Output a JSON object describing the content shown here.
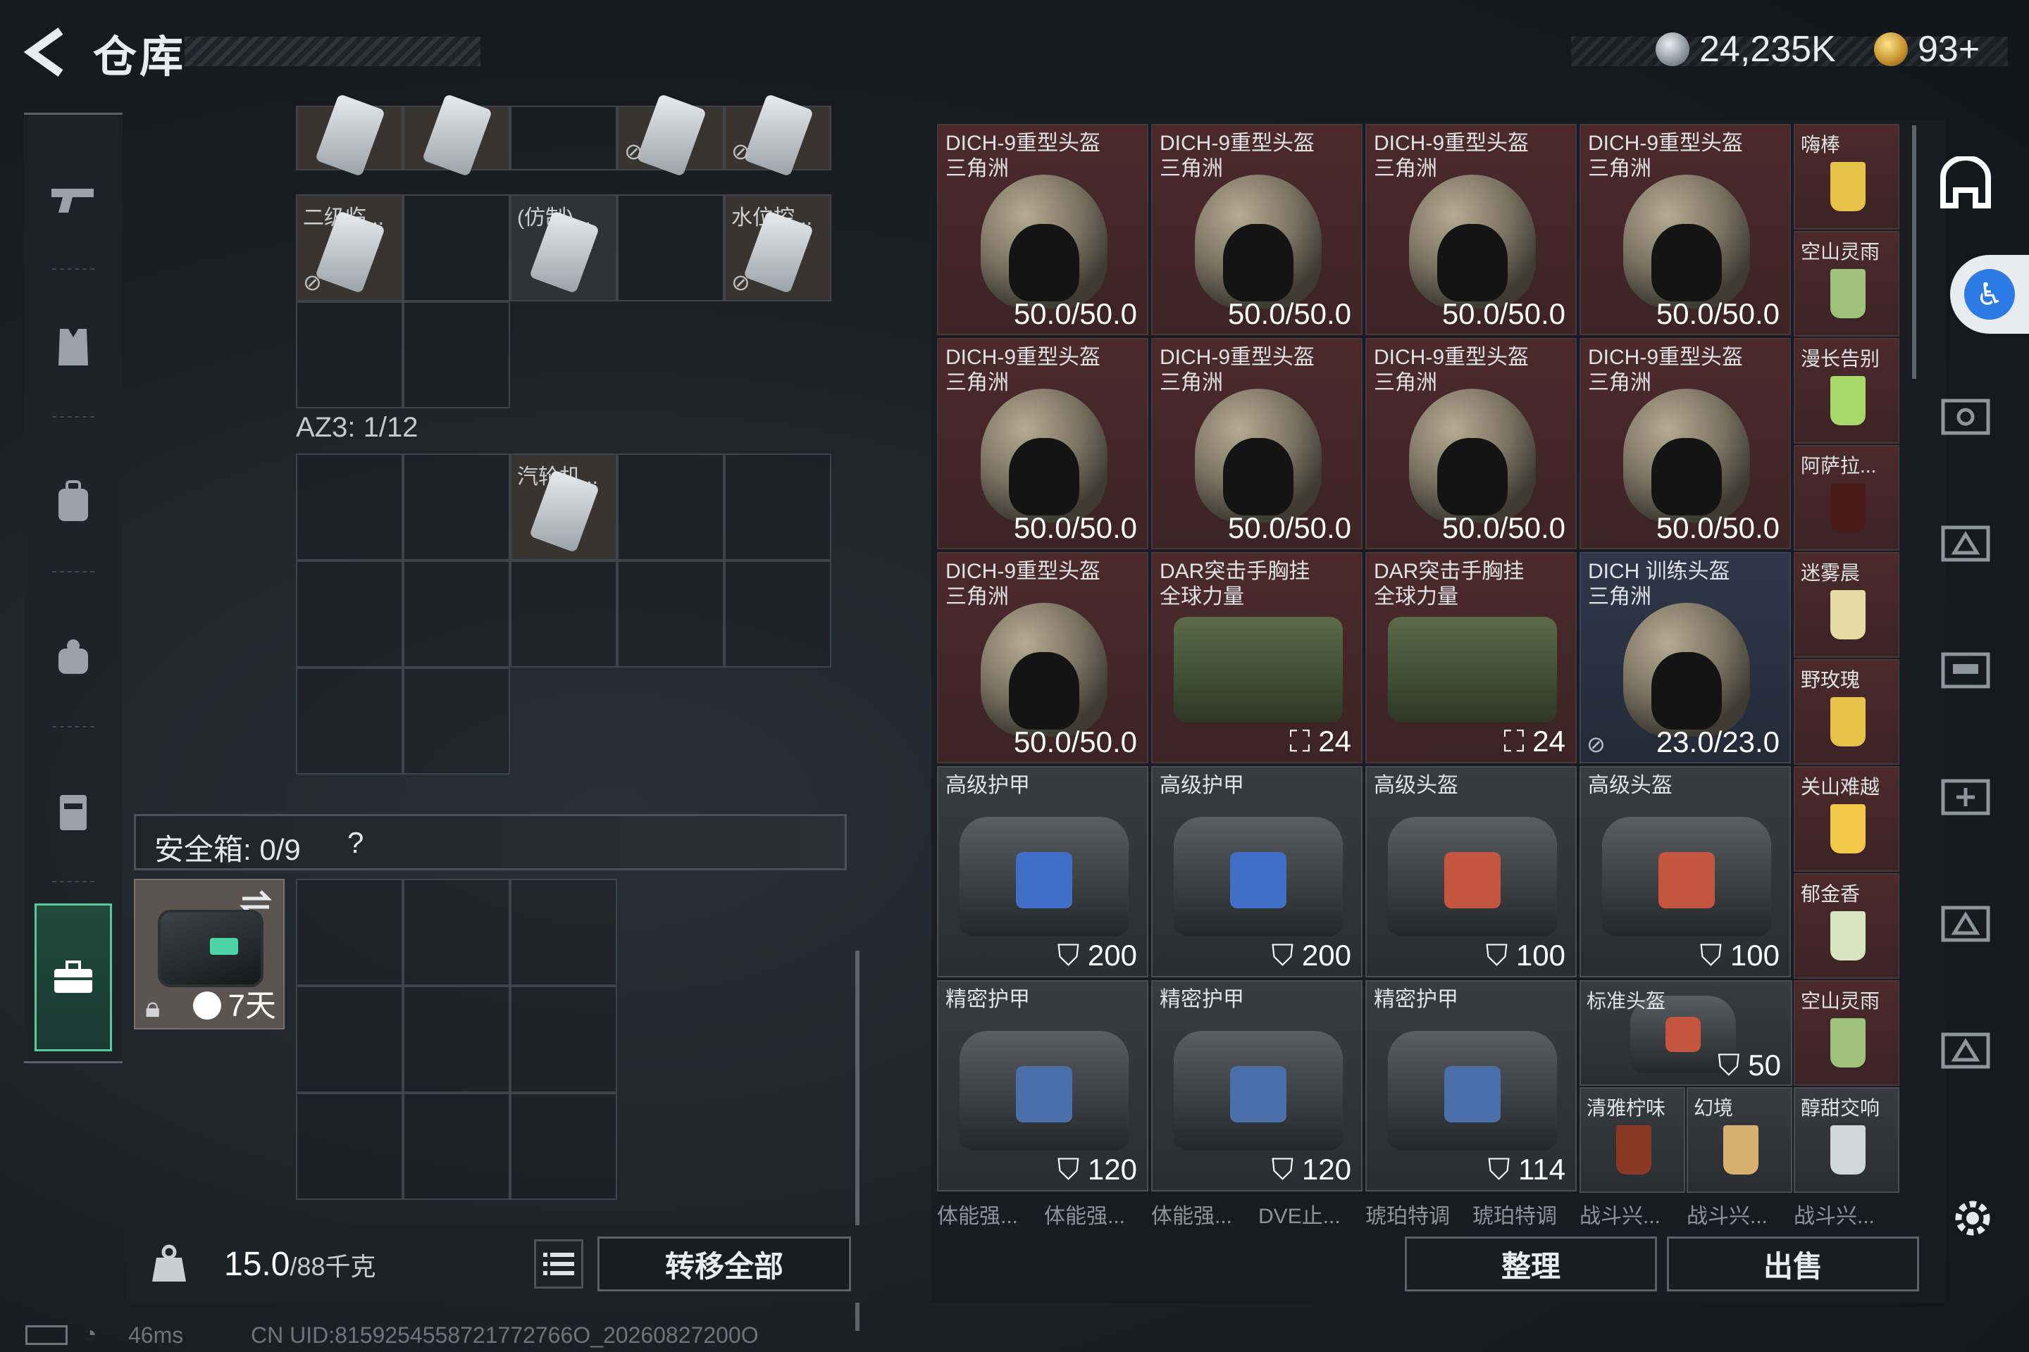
{
  "header": {
    "title": "仓库",
    "currency_silver": "24,235K",
    "currency_gold": "93+"
  },
  "left_nav": {
    "items": [
      "gun-icon",
      "vest-icon",
      "backpack-icon",
      "bag-icon",
      "chest-rig-icon",
      "safebox-icon"
    ]
  },
  "inventory": {
    "top_cells": [
      {
        "label": "二级临...",
        "icon": "card-icon"
      },
      {
        "label": "(仿制)...",
        "icon": "card-icon"
      },
      {
        "label": "水位控...",
        "icon": "card-icon"
      }
    ],
    "az3_label": "AZ3: 1/12",
    "az3_item": "汽轮机...",
    "safebox_label": "安全箱:  0/9",
    "safebox_help": "?",
    "safebox_days": "7天"
  },
  "footer_left": {
    "weight_value": "15.0",
    "weight_max": "/88千克",
    "transfer_all": "转移全部"
  },
  "storage": {
    "items": [
      {
        "name": "DICH-9重型头盔\n三角洲",
        "value": "50.0/50.0",
        "type": "helmet"
      },
      {
        "name": "DICH-9重型头盔\n三角洲",
        "value": "50.0/50.0",
        "type": "helmet"
      },
      {
        "name": "DICH-9重型头盔\n三角洲",
        "value": "50.0/50.0",
        "type": "helmet"
      },
      {
        "name": "DICH-9重型头盔\n三角洲",
        "value": "50.0/50.0",
        "type": "helmet"
      },
      {
        "name": "DICH-9重型头盔\n三角洲",
        "value": "50.0/50.0",
        "type": "helmet"
      },
      {
        "name": "DICH-9重型头盔\n三角洲",
        "value": "50.0/50.0",
        "type": "helmet"
      },
      {
        "name": "DICH-9重型头盔\n三角洲",
        "value": "50.0/50.0",
        "type": "helmet"
      },
      {
        "name": "DICH-9重型头盔\n三角洲",
        "value": "50.0/50.0",
        "type": "helmet"
      },
      {
        "name": "DICH-9重型头盔\n三角洲",
        "value": "50.0/50.0",
        "type": "helmet"
      },
      {
        "name": "DAR突击手胸挂\n全球力量",
        "value": "24",
        "type": "vest"
      },
      {
        "name": "DAR突击手胸挂\n全球力量",
        "value": "24",
        "type": "vest"
      },
      {
        "name": "DICH 训练头盔\n三角洲",
        "value": "23.0/23.0",
        "type": "helmet-blue"
      },
      {
        "name": "高级护甲",
        "value": "200",
        "type": "armor-blue"
      },
      {
        "name": "高级护甲",
        "value": "200",
        "type": "armor-blue"
      },
      {
        "name": "高级头盔",
        "value": "100",
        "type": "armor-red"
      },
      {
        "name": "高级头盔",
        "value": "100",
        "type": "armor-red"
      },
      {
        "name": "精密护甲",
        "value": "120",
        "type": "armor-grey"
      },
      {
        "name": "精密护甲",
        "value": "120",
        "type": "armor-grey"
      },
      {
        "name": "精密护甲",
        "value": "114",
        "type": "armor-grey"
      }
    ],
    "drinks": [
      "嗨棒",
      "空山灵雨",
      "漫长告别",
      "阿萨拉...",
      "迷雾晨",
      "野玫瑰",
      "关山难越",
      "郁金香",
      "空山灵雨"
    ],
    "standard_helmet": {
      "name": "标准头盔",
      "value": "50"
    },
    "bottom_small": [
      "清雅柠味",
      "幻境",
      "醇甜交响"
    ],
    "bottom_row": [
      "体能强...",
      "体能强...",
      "体能强...",
      "DVE止...",
      "琥珀特调",
      "琥珀特调",
      "战斗兴...",
      "战斗兴...",
      "战斗兴..."
    ]
  },
  "footer_right": {
    "sort": "整理",
    "sell": "出售"
  },
  "status": {
    "ping": "46ms",
    "uid": "CN UID:8159254558721772766O_20260827200O"
  },
  "colors": {
    "accent_green": "#58c99b",
    "item_red": "#4c2a2c",
    "item_blue": "#2f3749"
  }
}
